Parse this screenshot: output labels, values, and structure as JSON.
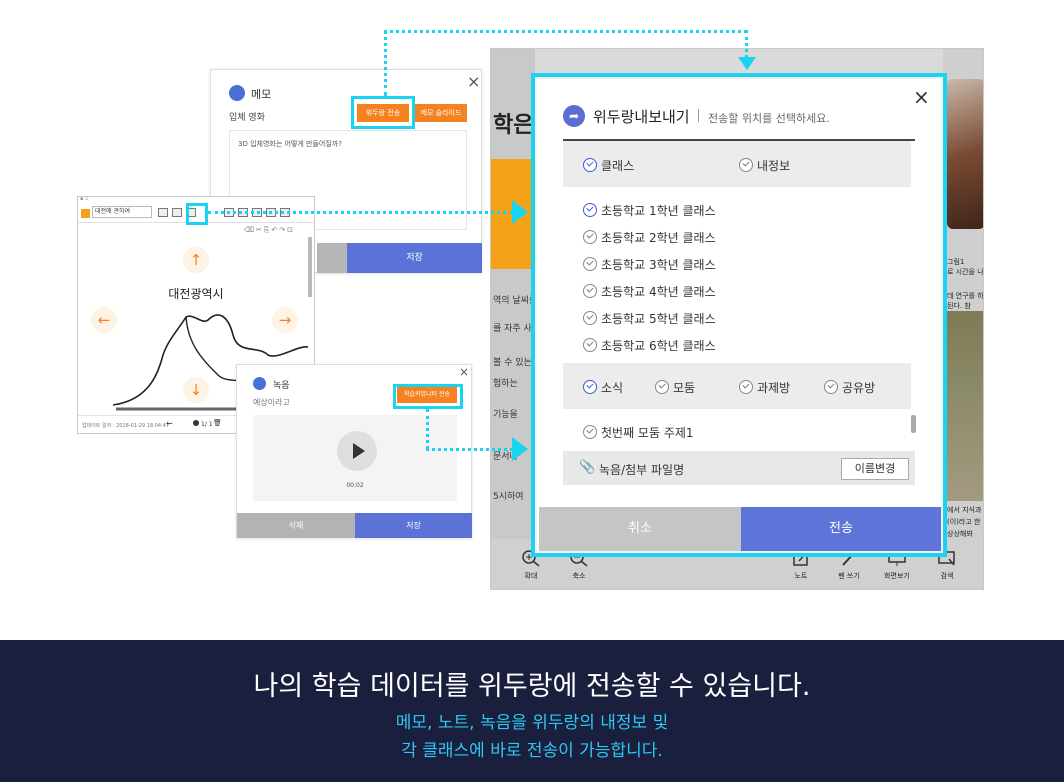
{
  "book": {
    "left_text": "학은",
    "snippets": [
      "역의 날씨를",
      "를 자주 사용",
      "볼 수 있는 2",
      "험하는",
      "기능을",
      "문서나",
      "5시하여"
    ],
    "right_texts": [
      "그림1",
      "로 시간을 나",
      "데 연구를 하",
      "된다. 참",
      "에서 지식과 함",
      "(이)라고 한",
      "상상해봐"
    ],
    "tools_left": [
      "확대",
      "축소"
    ],
    "tools_right": [
      "노트",
      "펜 쓰기",
      "화면보기",
      "검색"
    ]
  },
  "memo": {
    "title": "메모",
    "subject": "입체 영화",
    "send_button": "위두랑 전송",
    "slide_button": "메모 슬라이드",
    "body": "3D 입체영화는 어떻게 만들어질까?",
    "save": "저장"
  },
  "note": {
    "combo": "대전에 관하여",
    "city": "대전광역시",
    "footer_left": "업데이트 일자 : 2018-01-29 18:04:47",
    "page": "1",
    "page_total": "/ 1"
  },
  "recording": {
    "title": "녹음",
    "subtitle": "예상이라고",
    "send_button": "학습커뮤니티 전송",
    "time": "00:02",
    "delete": "삭제",
    "save": "저장"
  },
  "export": {
    "title": "위두랑내보내기",
    "subtitle": "전송할 위치를 선택하세요.",
    "groups1": [
      "클래스",
      "내정보"
    ],
    "classes": [
      "초등학교 1학년 클래스",
      "초등학교 2학년 클래스",
      "초등학교 3학년 클래스",
      "초등학교 4학년 클래스",
      "초등학교 5학년 클래스",
      "초등학교 6학년 클래스"
    ],
    "groups2": [
      "소식",
      "모둠",
      "과제방",
      "공유방"
    ],
    "topic": "첫번째 모둠 주제1",
    "file_label": "녹음/첨부 파일명",
    "rename": "이름변경",
    "cancel": "취소",
    "send": "전송"
  },
  "banner": {
    "headline": "나의 학습 데이터를 위두랑에 전송할 수 있습니다.",
    "sub1": "메모, 노트, 녹음을 위두랑의 내정보 및",
    "sub2": "각 클래스에 바로 전송이 가능합니다."
  },
  "colors": {
    "highlight": "#19d4f0",
    "accent_blue": "#5f74d8",
    "orange": "#f58220",
    "banner_bg": "#1a1f3d",
    "banner_sub": "#2ec7f2"
  }
}
